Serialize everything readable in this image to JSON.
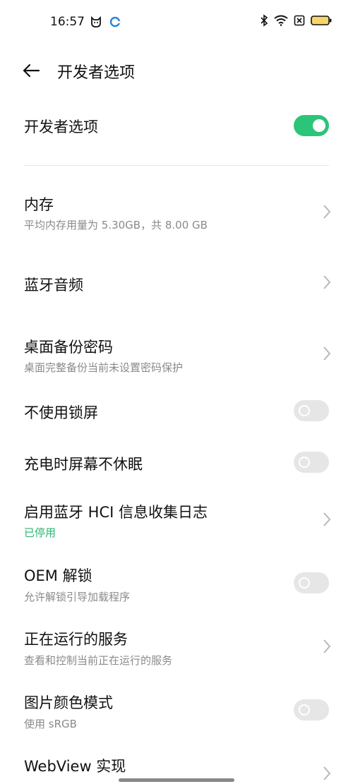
{
  "status": {
    "time": "16:57",
    "icons_left": [
      "cat-face-icon",
      "c-circle-icon"
    ],
    "icons_right": [
      "bluetooth-icon",
      "wifi-icon",
      "sim-x-icon",
      "battery-icon"
    ]
  },
  "header": {
    "title": "开发者选项",
    "back_icon": "arrow-left-icon"
  },
  "master": {
    "label": "开发者选项",
    "enabled": true
  },
  "rows": [
    {
      "label": "内存",
      "sub": "平均内存用量为 5.30GB，共 8.00 GB",
      "type": "chevron"
    },
    {
      "label": "蓝牙音频",
      "type": "chevron"
    },
    {
      "label": "桌面备份密码",
      "sub": "桌面完整备份当前未设置密码保护",
      "type": "chevron"
    },
    {
      "label": "不使用锁屏",
      "type": "toggle",
      "on": false
    },
    {
      "label": "充电时屏幕不休眠",
      "type": "toggle",
      "on": false
    },
    {
      "label": "启用蓝牙 HCI 信息收集日志",
      "sub": "已停用",
      "type": "chevron"
    },
    {
      "label": "OEM 解锁",
      "sub": "允许解锁引导加载程序",
      "type": "toggle",
      "on": false
    },
    {
      "label": "正在运行的服务",
      "sub": "查看和控制当前正在运行的服务",
      "type": "chevron"
    },
    {
      "label": "图片颜色模式",
      "sub": "使用 sRGB",
      "type": "toggle",
      "on": false
    },
    {
      "label": "WebView 实现",
      "type": "chevron"
    }
  ],
  "colors": {
    "accent": "#2bc57a",
    "subtext": "#8a8a8a",
    "status_green": "#2bb673"
  }
}
